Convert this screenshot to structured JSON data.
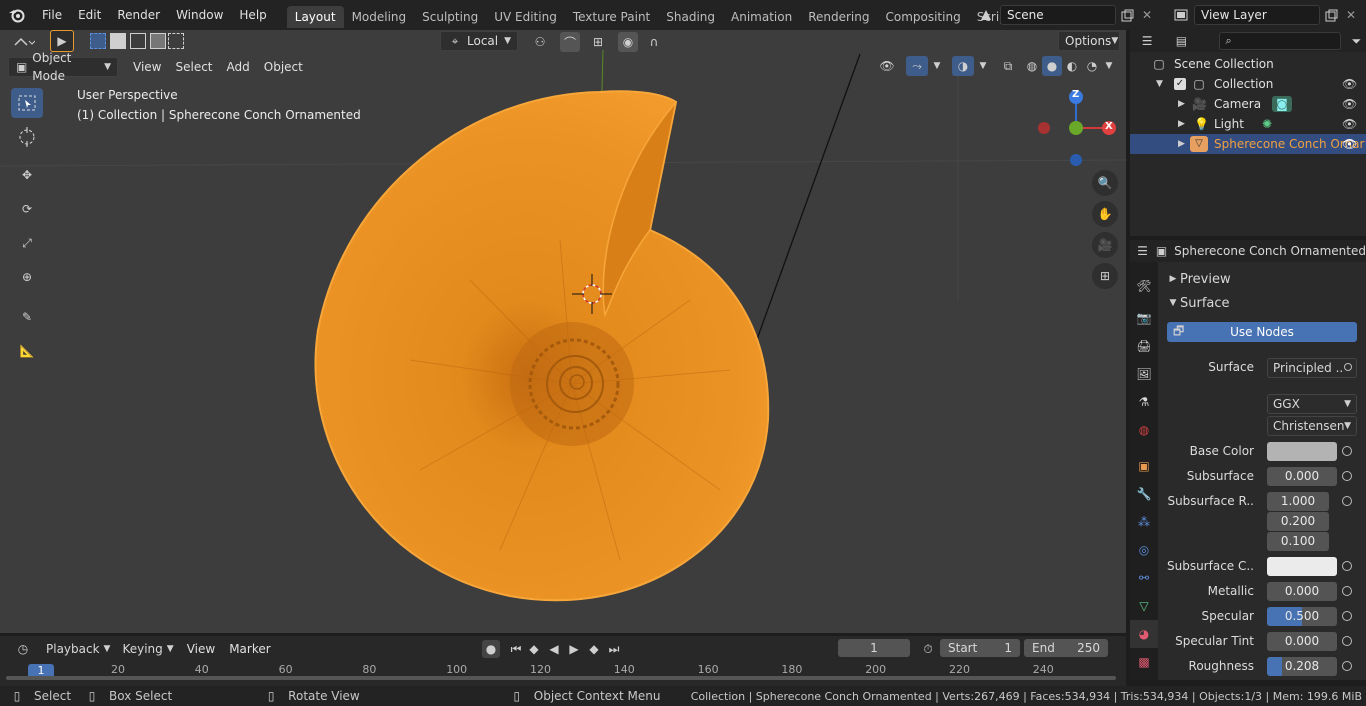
{
  "topbar": {
    "menus": [
      "File",
      "Edit",
      "Render",
      "Window",
      "Help"
    ],
    "workspaces": [
      "Layout",
      "Modeling",
      "Sculpting",
      "UV Editing",
      "Texture Paint",
      "Shading",
      "Animation",
      "Rendering",
      "Compositing",
      "Scripting"
    ],
    "scene_name": "Scene",
    "view_layer": "View Layer"
  },
  "viewport": {
    "orientation": "Local",
    "options_label": "Options",
    "mode": "Object Mode",
    "menus": [
      "View",
      "Select",
      "Add",
      "Object"
    ],
    "overlay_line1": "User Perspective",
    "overlay_line2": "(1) Collection | Spherecone Conch Ornamented",
    "gizmo": {
      "z": "Z",
      "x": "X"
    }
  },
  "outliner": {
    "rows": [
      {
        "label": "Scene Collection"
      },
      {
        "label": "Collection"
      },
      {
        "label": "Camera"
      },
      {
        "label": "Light"
      },
      {
        "label": "Spherecone Conch Ornar"
      }
    ]
  },
  "properties": {
    "object_name": "Spherecone Conch Ornamented",
    "preview_label": "Preview",
    "surface_panel": "Surface",
    "use_nodes": "Use Nodes",
    "surface_label": "Surface",
    "surface_value": "Principled ..",
    "distribution": "GGX",
    "subsurface_method": "Christensen-..",
    "rows": [
      {
        "label": "Base Color",
        "value": ""
      },
      {
        "label": "Subsurface",
        "value": "0.000"
      },
      {
        "label": "Subsurface R..",
        "value": "1.000"
      },
      {
        "label": "",
        "value": "0.200"
      },
      {
        "label": "",
        "value": "0.100"
      },
      {
        "label": "Subsurface C..",
        "value": ""
      },
      {
        "label": "Metallic",
        "value": "0.000"
      },
      {
        "label": "Specular",
        "value": "0.500"
      },
      {
        "label": "Specular Tint",
        "value": "0.000"
      },
      {
        "label": "Roughness",
        "value": "0.208"
      }
    ],
    "specular_fill": 0.5,
    "roughness_fill": 0.208
  },
  "timeline": {
    "menus": [
      "Playback",
      "Keying",
      "View",
      "Marker"
    ],
    "current_frame": "1",
    "start_label": "Start",
    "start_value": "1",
    "end_label": "End",
    "end_value": "250",
    "ruler": [
      "20",
      "40",
      "60",
      "80",
      "100",
      "120",
      "140",
      "160",
      "180",
      "200",
      "220",
      "240"
    ],
    "ruler_current": "1"
  },
  "statusbar": {
    "select": "Select",
    "box_select": "Box Select",
    "rotate": "Rotate View",
    "context_menu": "Object Context Menu",
    "stats": "Collection | Spherecone Conch Ornamented | Verts:267,469 | Faces:534,934 | Tris:534,934 | Objects:1/3 | Mem: 199.6 MiB"
  },
  "colors": {
    "accent": "#4772b3",
    "selection_orange": "#f0a040",
    "shell": "#e8901e"
  }
}
